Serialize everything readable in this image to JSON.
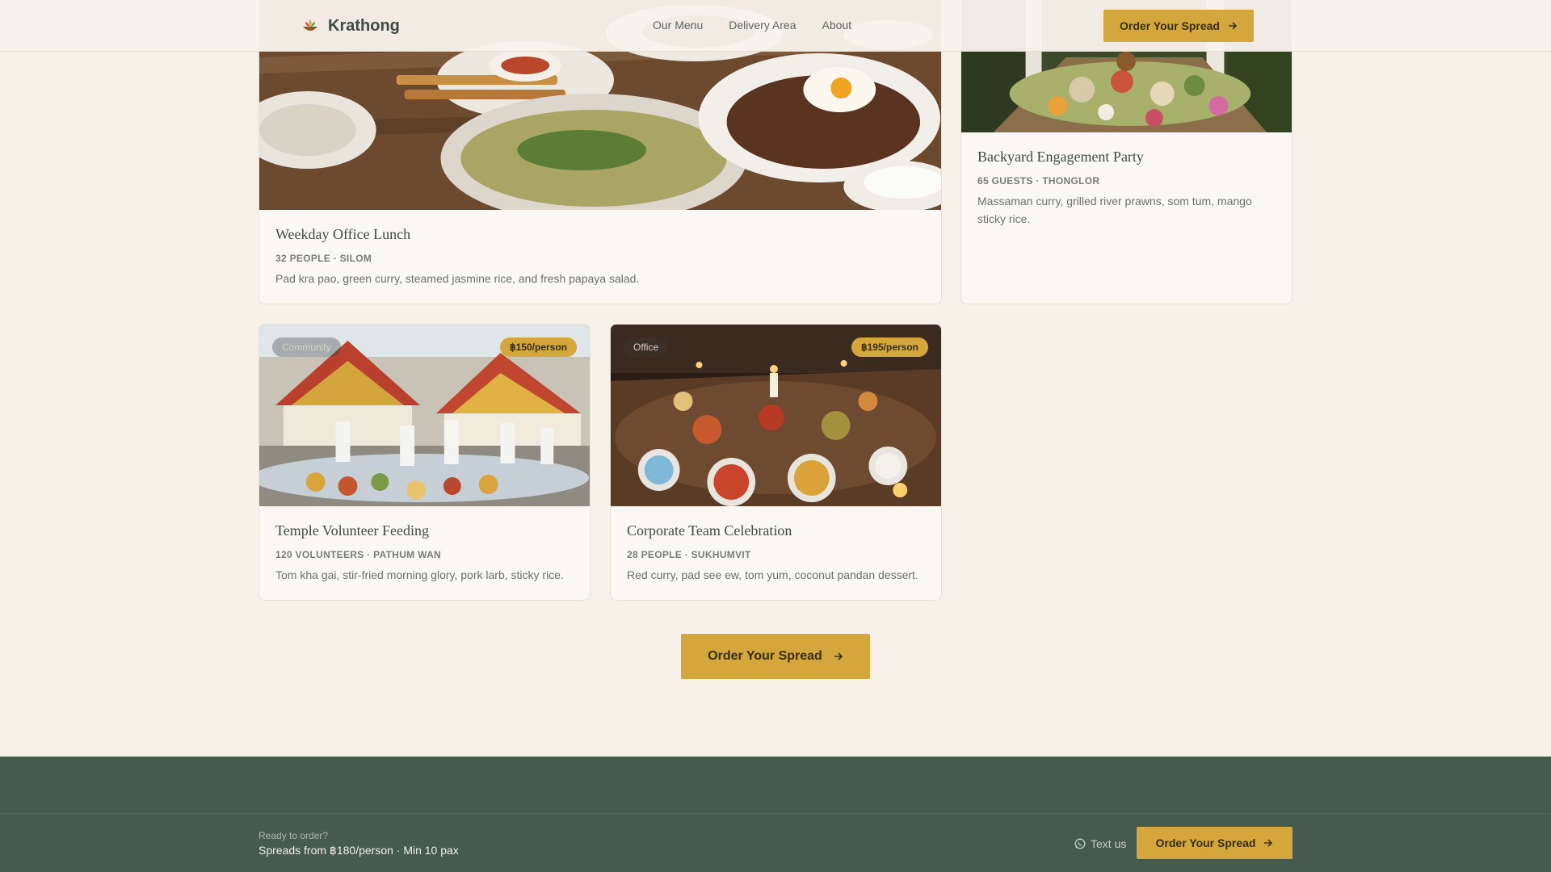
{
  "header": {
    "brand": "Krathong",
    "nav": [
      "Our Menu",
      "Delivery Area",
      "About"
    ],
    "cta": "Order Your Spread"
  },
  "cards": [
    {
      "title": "Weekday Office Lunch",
      "meta": "32 PEOPLE · SILOM",
      "desc": "Pad kra pao, green curry, steamed jasmine rice, and fresh papaya salad."
    },
    {
      "title": "Backyard Engagement Party",
      "meta": "65 GUESTS · THONGLOR",
      "desc": "Massaman curry, grilled river prawns, som tum, mango sticky rice."
    },
    {
      "title": "Temple Volunteer Feeding",
      "meta": "120 VOLUNTEERS · PATHUM WAN",
      "desc": "Tom kha gai, stir-fried morning glory, pork larb, sticky rice.",
      "tag": "Community",
      "price": "฿150/person"
    },
    {
      "title": "Corporate Team Celebration",
      "meta": "28 PEOPLE · SUKHUMVIT",
      "desc": "Red curry, pad see ew, tom yum, coconut pandan dessert.",
      "tag": "Office",
      "price": "฿195/person"
    }
  ],
  "main_cta": "Order Your Spread",
  "footer": {
    "ready": "Ready to order?",
    "ready_sub": "Spreads from ฿180/person · Min 10 pax",
    "text_us": "Text us",
    "cta": "Order Your Spread"
  },
  "colors": {
    "accent": "#d4a73d",
    "background": "#f7f1ea",
    "footer": "#475a4e",
    "text": "#3e4b43"
  },
  "icons": [
    "lotus-bowl-icon",
    "arrow-right-icon",
    "whatsapp-icon"
  ]
}
